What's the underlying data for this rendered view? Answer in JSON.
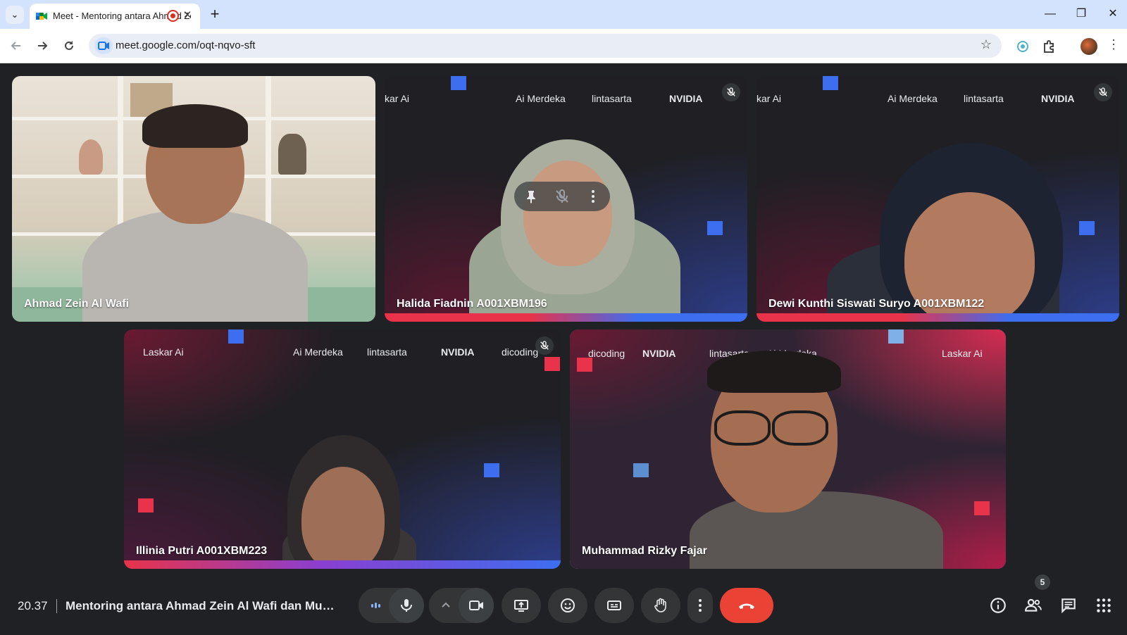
{
  "browser": {
    "tab": {
      "title": "Meet - Mentoring antara Ahmad Zein Al Wafi dan Muhammad Rizky Fajar",
      "close": "✕"
    },
    "new_tab": "+",
    "address": {
      "url": "meet.google.com/oqt-nqvo-sft"
    },
    "window_controls": {
      "minimize": "—",
      "restore": "❐",
      "close": "✕"
    }
  },
  "meeting": {
    "clock": "20.37",
    "title": "Mentoring antara Ahmad Zein Al Wafi dan Muha...",
    "participant_count": "5",
    "colors": {
      "end_call": "#ea4335",
      "active_speaker_border": "#a8c7fa",
      "background": "#202124"
    }
  },
  "tiles": [
    {
      "name": "Ahmad Zein Al Wafi",
      "muted": false,
      "background": "bookshelf"
    },
    {
      "name": "Halida Fiadnin A001XBM196",
      "muted": true,
      "background": "laskar-ai",
      "logos": [
        "kar Ai",
        "Ai Merdeka",
        "lintasarta",
        "NVIDIA"
      ]
    },
    {
      "name": "Dewi Kunthi Siswati Suryo A001XBM122",
      "muted": true,
      "background": "laskar-ai",
      "logos": [
        "kar Ai",
        "Ai Merdeka",
        "lintasarta",
        "NVIDIA"
      ]
    },
    {
      "name": "Illinia Putri A001XBM223",
      "muted": true,
      "background": "laskar-ai",
      "logos": [
        "Laskar Ai",
        "Ai Merdeka",
        "lintasarta",
        "NVIDIA",
        "dicoding"
      ]
    },
    {
      "name": "Muhammad Rizky Fajar",
      "muted": false,
      "active_speaker": true,
      "background": "laskar-ai-mirrored",
      "logos": [
        "dicoding",
        "NVIDIA",
        "lintasarta",
        "Ai Merdeka",
        "Laskar Ai"
      ]
    }
  ],
  "icons": {
    "tab_menu": "chevron-down-icon",
    "back": "arrow-left-icon",
    "forward": "arrow-right-icon",
    "reload": "reload-icon",
    "bookmark": "star-icon",
    "controls": [
      "audio-level-icon",
      "microphone-icon",
      "chevron-up-icon",
      "camera-icon",
      "present-screen-icon",
      "emoji-icon",
      "captions-icon",
      "raise-hand-icon",
      "more-options-icon",
      "end-call-icon"
    ],
    "right": [
      "info-icon",
      "people-icon",
      "chat-icon",
      "activities-icon"
    ]
  }
}
